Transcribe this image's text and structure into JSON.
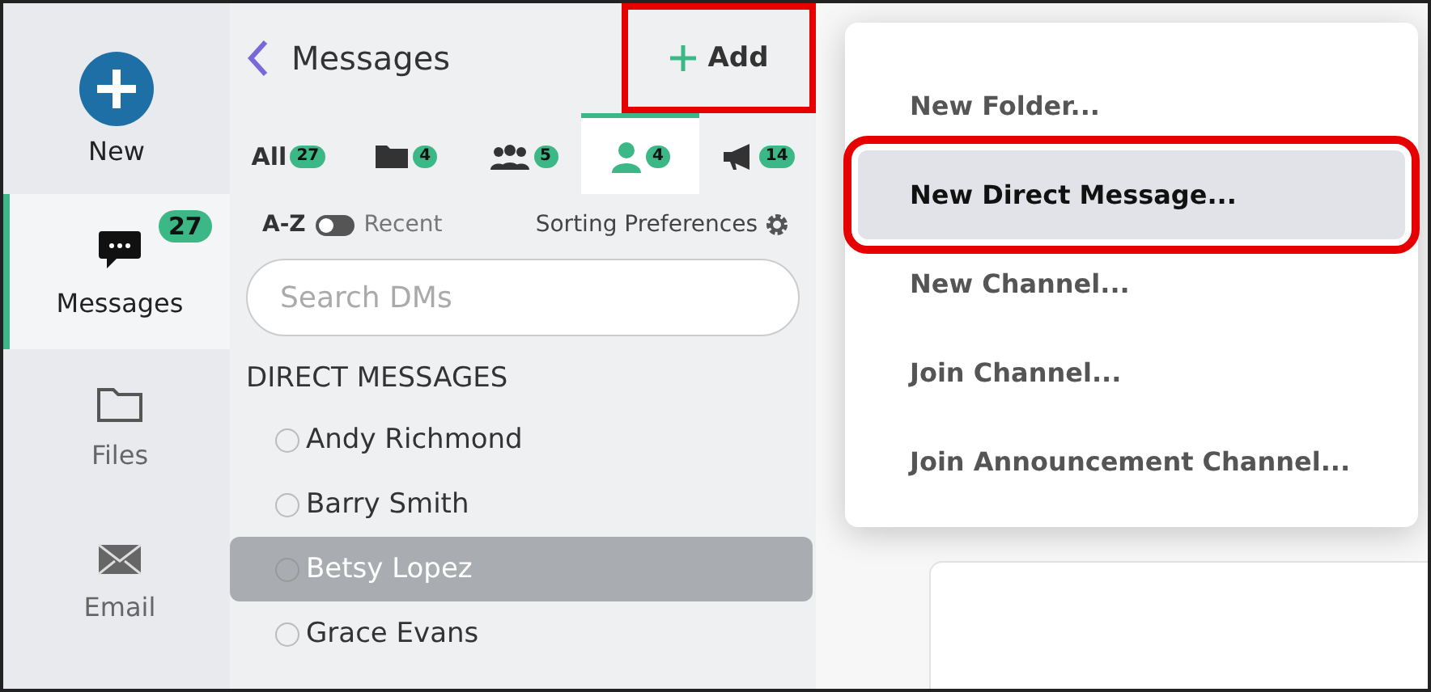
{
  "rail": {
    "new_label": "New",
    "items": [
      {
        "kind": "messages",
        "label": "Messages",
        "badge": "27",
        "selected": true
      },
      {
        "kind": "files",
        "label": "Files",
        "selected": false
      },
      {
        "kind": "email",
        "label": "Email",
        "selected": false
      }
    ]
  },
  "panel": {
    "title": "Messages",
    "add_button": {
      "label": "Add",
      "highlighted": true
    },
    "tabs": [
      {
        "label": "All",
        "count": "27",
        "selected": false
      },
      {
        "kind": "folder",
        "count": "4",
        "selected": false
      },
      {
        "kind": "group",
        "count": "5",
        "selected": false
      },
      {
        "kind": "person",
        "count": "4",
        "selected": true
      },
      {
        "kind": "megaphone",
        "count": "14",
        "selected": false
      }
    ],
    "sort": {
      "left": "A-Z",
      "right": "Recent",
      "on": false,
      "preferences": "Sorting Preferences"
    },
    "search": {
      "placeholder": "Search DMs"
    },
    "section": "DIRECT MESSAGES",
    "contacts": [
      {
        "name": "Andy Richmond",
        "selected": false
      },
      {
        "name": "Barry Smith",
        "selected": false
      },
      {
        "name": "Betsy Lopez",
        "selected": true
      },
      {
        "name": "Grace Evans",
        "selected": false
      }
    ]
  },
  "menu": {
    "items": [
      {
        "label": "New Folder...",
        "selected": false,
        "highlighted": false
      },
      {
        "label": "New Direct Message...",
        "selected": true,
        "highlighted": true
      },
      {
        "label": "New Channel...",
        "selected": false,
        "highlighted": false
      },
      {
        "label": "Join Channel...",
        "selected": false,
        "highlighted": false
      },
      {
        "label": "Join Announcement Channel...",
        "selected": false,
        "highlighted": false
      }
    ]
  }
}
